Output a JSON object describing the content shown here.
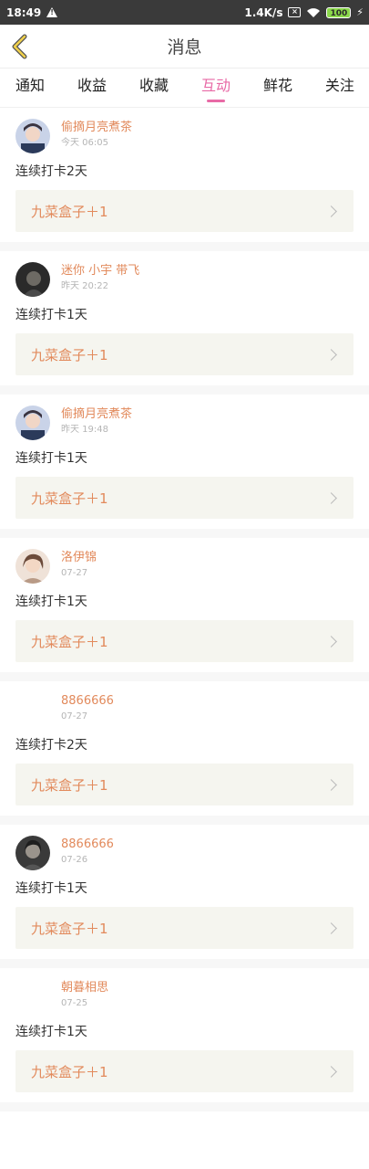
{
  "status_bar": {
    "time": "18:49",
    "net_speed": "1.4K/s",
    "battery": "100"
  },
  "header": {
    "title": "消息"
  },
  "tabs": [
    {
      "label": "通知"
    },
    {
      "label": "收益"
    },
    {
      "label": "收藏"
    },
    {
      "label": "互动",
      "active": true
    },
    {
      "label": "鲜花"
    },
    {
      "label": "关注"
    }
  ],
  "colors": {
    "accent": "#e86aa6",
    "username": "#e28a5c",
    "reward": "#e28a5c"
  },
  "feed": [
    {
      "username": "偷摘月亮煮茶",
      "time": "今天 06:05",
      "message": "连续打卡2天",
      "reward": "九菜盒子＋1"
    },
    {
      "username": "迷你 小宇 带飞",
      "time": "昨天 20:22",
      "message": "连续打卡1天",
      "reward": "九菜盒子＋1"
    },
    {
      "username": "偷摘月亮煮茶",
      "time": "昨天 19:48",
      "message": "连续打卡1天",
      "reward": "九菜盒子＋1"
    },
    {
      "username": "洛伊锦",
      "time": "07-27",
      "message": "连续打卡1天",
      "reward": "九菜盒子＋1"
    },
    {
      "username": "8866666",
      "time": "07-27",
      "message": "连续打卡2天",
      "reward": "九菜盒子＋1"
    },
    {
      "username": "8866666",
      "time": "07-26",
      "message": "连续打卡1天",
      "reward": "九菜盒子＋1"
    },
    {
      "username": "朝暮相思",
      "time": "07-25",
      "message": "连续打卡1天",
      "reward": "九菜盒子＋1"
    }
  ]
}
